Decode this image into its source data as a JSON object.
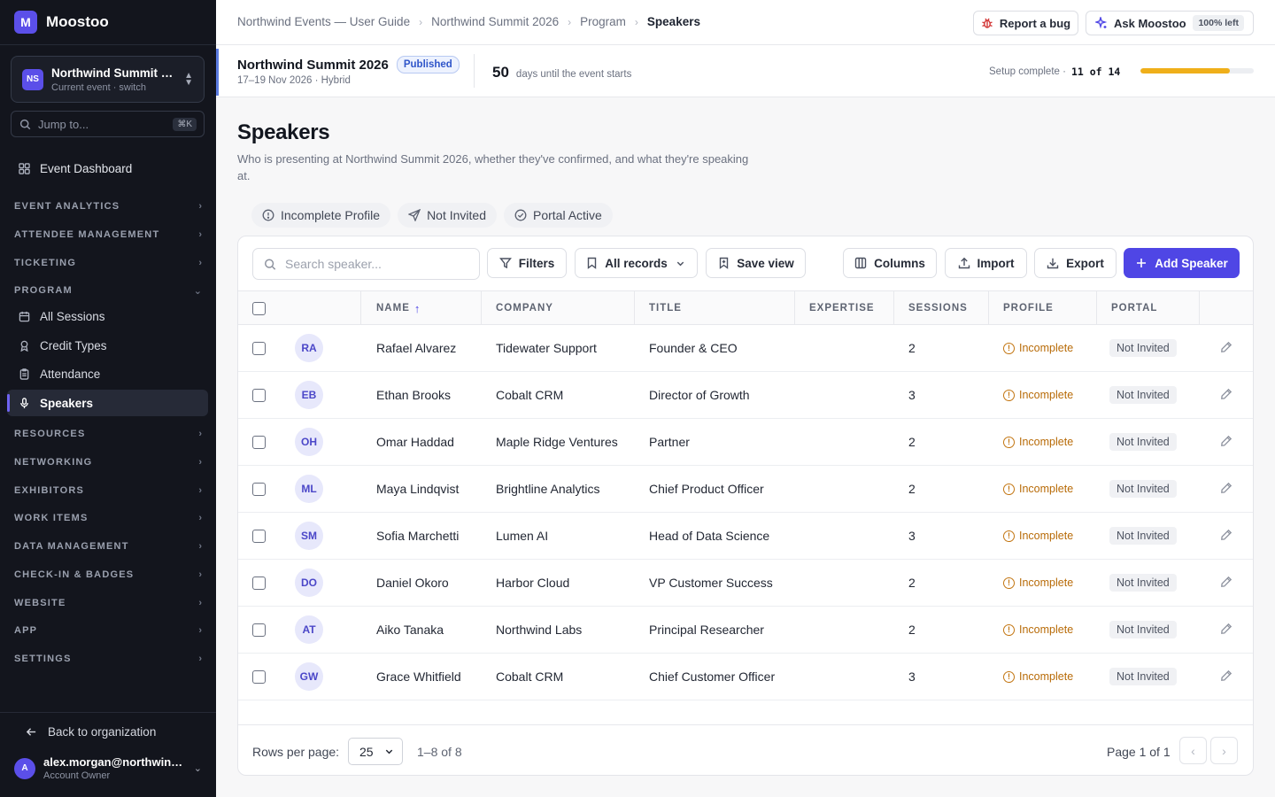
{
  "app": {
    "name": "Moostoo",
    "logo_letter": "M",
    "accent": "#5b4fe9"
  },
  "event_switcher": {
    "initials": "NS",
    "name": "Northwind Summit 2...",
    "subtitle": "Current event · switch"
  },
  "jump": {
    "placeholder": "Jump to...",
    "shortcut": "⌘K"
  },
  "sidebar": {
    "dashboard": "Event Dashboard",
    "sections": {
      "event_analytics": "EVENT ANALYTICS",
      "attendee_management": "ATTENDEE MANAGEMENT",
      "ticketing": "TICKETING",
      "program": "PROGRAM",
      "resources": "RESOURCES",
      "networking": "NETWORKING",
      "exhibitors": "EXHIBITORS",
      "work_items": "WORK ITEMS",
      "data_management": "DATA MANAGEMENT",
      "checkin_badges": "CHECK-IN & BADGES",
      "website": "WEBSITE",
      "app": "APP",
      "settings": "SETTINGS"
    },
    "program_items": {
      "all_sessions": "All Sessions",
      "credit_types": "Credit Types",
      "attendance": "Attendance",
      "speakers": "Speakers"
    },
    "back": "Back to organization",
    "user": {
      "initial": "A",
      "email": "alex.morgan@northwind...",
      "role": "Account Owner"
    }
  },
  "topbar": {
    "breadcrumb": [
      "Northwind Events — User Guide",
      "Northwind Summit 2026",
      "Program",
      "Speakers"
    ],
    "report_bug": "Report a bug",
    "ask": "Ask Moostoo",
    "ask_badge": "100% left"
  },
  "event": {
    "name": "Northwind Summit 2026",
    "status": "Published",
    "dates": "17–19 Nov 2026 · Hybrid",
    "countdown_num": "50",
    "countdown_text": "days until the event starts",
    "setup_label": "Setup complete ·",
    "setup_count": "11 of 14",
    "setup_fraction": 0.786,
    "progress_color": "#efaf1a"
  },
  "page": {
    "title": "Speakers",
    "description": "Who is presenting at Northwind Summit 2026, whether they've confirmed, and what they're speaking at."
  },
  "chips": [
    "Incomplete Profile",
    "Not Invited",
    "Portal Active"
  ],
  "toolbar": {
    "search_placeholder": "Search speaker...",
    "filters": "Filters",
    "all_records": "All records",
    "save_view": "Save view",
    "columns": "Columns",
    "import": "Import",
    "export": "Export",
    "add": "Add Speaker"
  },
  "table": {
    "headers": {
      "name": "NAME",
      "company": "COMPANY",
      "title": "TITLE",
      "expertise": "EXPERTISE",
      "sessions": "SESSIONS",
      "profile": "PROFILE",
      "portal": "PORTAL"
    },
    "sort_indicator": "↑",
    "rows": [
      {
        "initials": "RA",
        "name": "Rafael Alvarez",
        "company": "Tidewater Support",
        "title": "Founder & CEO",
        "expertise": "",
        "sessions": "2",
        "profile": "Incomplete",
        "portal": "Not Invited"
      },
      {
        "initials": "EB",
        "name": "Ethan Brooks",
        "company": "Cobalt CRM",
        "title": "Director of Growth",
        "expertise": "",
        "sessions": "3",
        "profile": "Incomplete",
        "portal": "Not Invited"
      },
      {
        "initials": "OH",
        "name": "Omar Haddad",
        "company": "Maple Ridge Ventures",
        "title": "Partner",
        "expertise": "",
        "sessions": "2",
        "profile": "Incomplete",
        "portal": "Not Invited"
      },
      {
        "initials": "ML",
        "name": "Maya Lindqvist",
        "company": "Brightline Analytics",
        "title": "Chief Product Officer",
        "expertise": "",
        "sessions": "2",
        "profile": "Incomplete",
        "portal": "Not Invited"
      },
      {
        "initials": "SM",
        "name": "Sofia Marchetti",
        "company": "Lumen AI",
        "title": "Head of Data Science",
        "expertise": "",
        "sessions": "3",
        "profile": "Incomplete",
        "portal": "Not Invited"
      },
      {
        "initials": "DO",
        "name": "Daniel Okoro",
        "company": "Harbor Cloud",
        "title": "VP Customer Success",
        "expertise": "",
        "sessions": "2",
        "profile": "Incomplete",
        "portal": "Not Invited"
      },
      {
        "initials": "AT",
        "name": "Aiko Tanaka",
        "company": "Northwind Labs",
        "title": "Principal Researcher",
        "expertise": "",
        "sessions": "2",
        "profile": "Incomplete",
        "portal": "Not Invited"
      },
      {
        "initials": "GW",
        "name": "Grace Whitfield",
        "company": "Cobalt CRM",
        "title": "Chief Customer Officer",
        "expertise": "",
        "sessions": "3",
        "profile": "Incomplete",
        "portal": "Not Invited"
      }
    ]
  },
  "pagination": {
    "rows_label": "Rows per page:",
    "rows_value": "25",
    "range": "1–8 of 8",
    "page": "Page 1 of 1"
  }
}
